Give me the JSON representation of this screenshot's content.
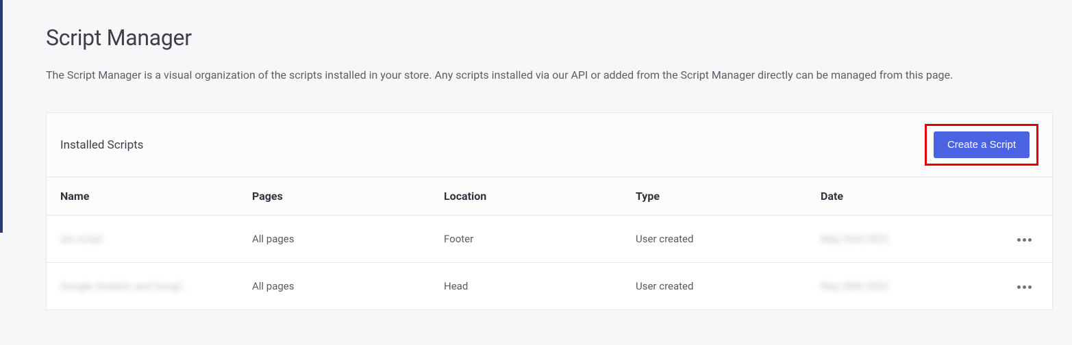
{
  "page": {
    "title": "Script Manager",
    "description": "The Script Manager is a visual organization of the scripts installed in your store. Any scripts installed via our API or added from the Script Manager directly can be managed from this page."
  },
  "panel": {
    "header_title": "Installed Scripts",
    "create_button_label": "Create a Script"
  },
  "table": {
    "columns": {
      "name": "Name",
      "pages": "Pages",
      "location": "Location",
      "type": "Type",
      "date": "Date"
    },
    "rows": [
      {
        "name": "ala script",
        "pages": "All pages",
        "location": "Footer",
        "type": "User created",
        "date": "May 33rd 2022"
      },
      {
        "name": "Google Analytic and Googl...",
        "pages": "All pages",
        "location": "Head",
        "type": "User created",
        "date": "May 30th 2022"
      }
    ]
  }
}
